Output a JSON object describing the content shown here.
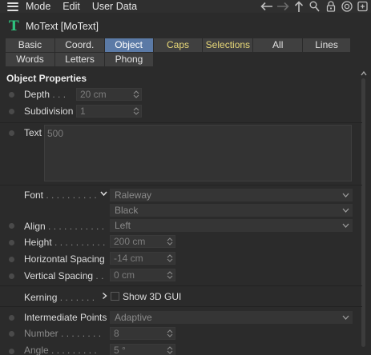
{
  "menu": {
    "items": [
      "Mode",
      "Edit",
      "User Data"
    ]
  },
  "nav_icons": [
    "arrow-left-icon",
    "arrow-right-icon",
    "arrow-up-icon",
    "search-icon",
    "lock-icon",
    "target-icon",
    "new-window-icon"
  ],
  "object": {
    "title": "MoText [MoText]"
  },
  "tabs": {
    "row1": [
      "Basic",
      "Coord.",
      "Object",
      "Caps",
      "Selections",
      "All",
      "Lines"
    ],
    "row2": [
      "Words",
      "Letters",
      "Phong"
    ],
    "active": "Object"
  },
  "section": {
    "title": "Object Properties"
  },
  "props": {
    "depth": {
      "label": "Depth",
      "dots": " . . . ",
      "value": "20 cm"
    },
    "subdivision": {
      "label": "Subdivision",
      "value": "1"
    },
    "text": {
      "label": "Text",
      "value": "500"
    },
    "font": {
      "label": "Font",
      "dots": " . . . . . . . . . . ",
      "family": "Raleway",
      "style": "Black"
    },
    "align": {
      "label": "Align",
      "dots": " . . . . . . . . . . . ",
      "value": "Left"
    },
    "height": {
      "label": "Height",
      "dots": " . . . . . . . . . . ",
      "value": "200 cm"
    },
    "hspacing": {
      "label": "Horizontal Spacing",
      "value": "-14 cm"
    },
    "vspacing": {
      "label": "Vertical Spacing",
      "dots": " . . ",
      "value": "0 cm"
    },
    "kerning": {
      "label": "Kerning",
      "dots": " . . . . . . . ",
      "checkbox_label": "Show 3D GUI"
    },
    "intermediate": {
      "label": "Intermediate Points",
      "value": "Adaptive"
    },
    "number": {
      "label": "Number",
      "dots": " . . . . . . . . ",
      "value": "8"
    },
    "angle": {
      "label": "Angle",
      "dots": " . . . . . . . . . ",
      "value": "5 °"
    }
  },
  "colors": {
    "background": "#2b2b2b",
    "tab_active": "#5b7aa6",
    "tab_yellow_text": "#e8d878",
    "logo_green": "#2ec27e"
  }
}
